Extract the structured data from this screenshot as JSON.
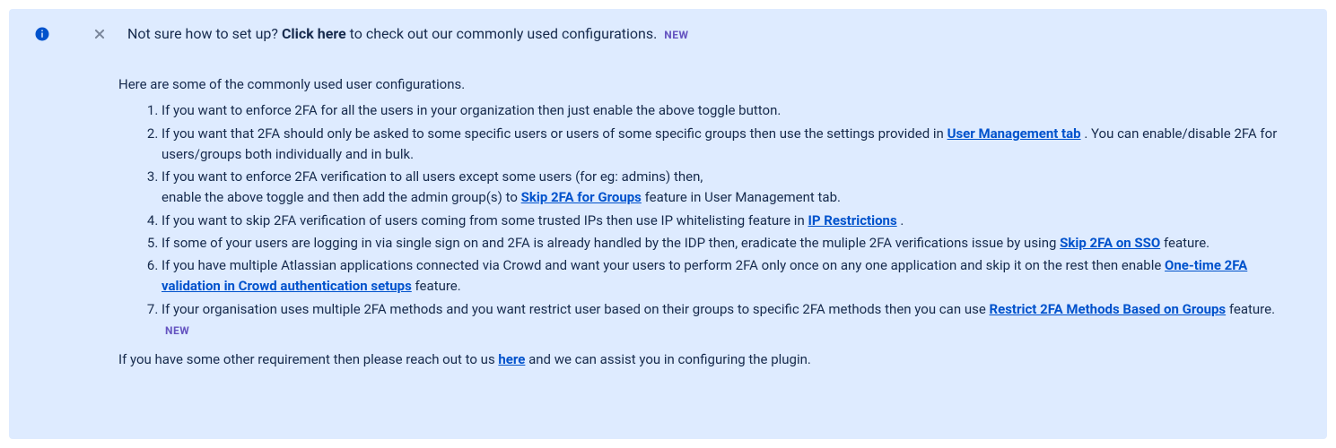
{
  "header": {
    "prefix": "Not sure how to set up? ",
    "click_here": "Click here",
    "suffix": " to check out our commonly used configurations. ",
    "new_badge": "NEW"
  },
  "intro": "Here are some of the commonly used user configurations.",
  "items": {
    "i1": "If you want to enforce 2FA for all the users in your organization then just enable the above toggle button.",
    "i2a": "If you want that 2FA should only be asked to some specific users or users of some specific groups then use the settings provided in ",
    "i2_link": "User Management tab",
    "i2b": " . You can enable/disable 2FA for users/groups both individually and in bulk.",
    "i3a": "If you want to enforce 2FA verification to all users except some users (for eg: admins) then,",
    "i3b": "enable the above toggle and then add the admin group(s) to ",
    "i3_link": "Skip 2FA for Groups",
    "i3c": " feature in User Management tab.",
    "i4a": "If you want to skip 2FA verification of users coming from some trusted IPs then use IP whitelisting feature in ",
    "i4_link": "IP Restrictions",
    "i4b": " .",
    "i5a": "If some of your users are logging in via single sign on and 2FA is already handled by the IDP then, eradicate the muliple 2FA verifications issue by using ",
    "i5_link": "Skip 2FA on SSO",
    "i5b": " feature.",
    "i6a": "If you have multiple Atlassian applications connected via Crowd and want your users to perform 2FA only once on any one application and skip it on the rest then enable ",
    "i6_link": "One-time 2FA validation in Crowd authentication setups",
    "i6b": " feature.",
    "i7a": "If your organisation uses multiple 2FA methods and you want restrict user based on their groups to specific 2FA methods then you can use ",
    "i7_link": "Restrict 2FA Methods Based on Groups",
    "i7b": " feature.  "
  },
  "outro": {
    "a": "If you have some other requirement then please reach out to us ",
    "link": "here",
    "b": " and we can assist you in configuring the plugin."
  }
}
